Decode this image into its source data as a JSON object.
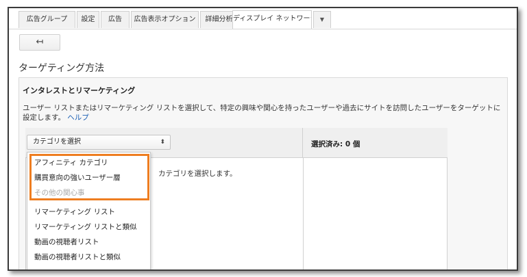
{
  "tabs": [
    {
      "label": "広告グループ",
      "active": false
    },
    {
      "label": "設定",
      "active": false
    },
    {
      "label": "広告",
      "active": false
    },
    {
      "label": "広告表示オプション",
      "active": false
    },
    {
      "label": "詳細分析",
      "active": false
    },
    {
      "label": "ディスプレイ ネットワーク",
      "active": true
    }
  ],
  "tab_more_icon": "▼",
  "back_button": {
    "icon": "↤"
  },
  "page_title": "ターゲティング方法",
  "panel": {
    "title": "インタレストとリマーケティング",
    "description": "ユーザー リストまたはリマーケティング リストを選択して、特定の興味や関心を持ったユーザーや過去にサイトを訪問したユーザーをターゲットに設定します。",
    "help_link": "ヘルプ"
  },
  "category_select": {
    "value": "カテゴリを選択",
    "arrow": "⬍"
  },
  "selected_header": "選択済み: 0 個",
  "hint_text": "カテゴリを選択します。",
  "dropdown": {
    "items": [
      {
        "label": "アフィニティ カテゴリ",
        "disabled": false
      },
      {
        "label": "購買意向の強いユーザー層",
        "disabled": false
      },
      {
        "label": "その他の関心事",
        "disabled": true
      },
      {
        "label": "リマーケティング リスト",
        "disabled": false
      },
      {
        "label": "リマーケティング リストと類似",
        "disabled": false
      },
      {
        "label": "動画の視聴者リスト",
        "disabled": false
      },
      {
        "label": "動画の視聴者リストと類似",
        "disabled": false
      }
    ]
  },
  "colors": {
    "highlight": "#ee7d20",
    "link": "#1a5fb4"
  }
}
